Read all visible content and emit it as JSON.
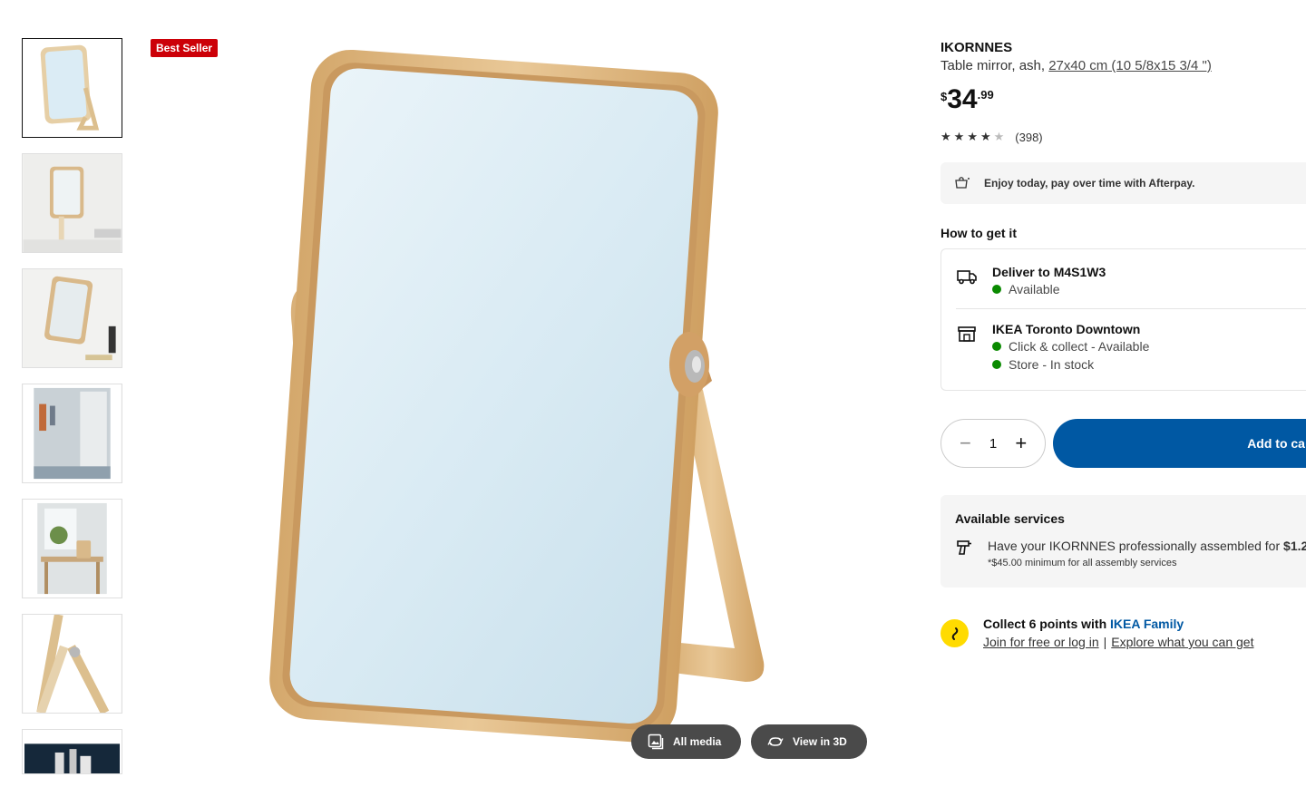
{
  "badge": "Best Seller",
  "thumbnails": [
    {
      "name": "mirror-front"
    },
    {
      "name": "mirror-on-shelf"
    },
    {
      "name": "mirror-with-decor"
    },
    {
      "name": "wall-hooks-room"
    },
    {
      "name": "desk-room-scene"
    },
    {
      "name": "hinge-detail"
    },
    {
      "name": "dark-shelf-scene"
    }
  ],
  "media_buttons": {
    "all_media": "All media",
    "view_3d": "View in 3D"
  },
  "product": {
    "name": "IKORNNES",
    "description": "Table mirror, ash,",
    "size": "27x40 cm (10 5/8x15 3/4 \")",
    "price_currency": "$",
    "price_int": "34",
    "price_dec": ".99",
    "rating_value": 4.5,
    "rating_count": "(398)"
  },
  "afterpay": {
    "icon": "afterpay-icon",
    "text": "Enjoy today, pay over time with Afterpay."
  },
  "how_to_get": {
    "heading": "How to get it",
    "delivery": {
      "title": "Deliver to M4S1W3",
      "status": "Available",
      "icon": "truck-icon"
    },
    "store": {
      "title": "IKEA Toronto Downtown",
      "status_1": "Click & collect - Available",
      "status_2": "Store - In stock",
      "icon": "store-icon"
    },
    "status_color": "#0a8a00"
  },
  "cart": {
    "quantity": "1",
    "minus": "−",
    "plus": "+",
    "add_label": "Add to ca",
    "color": "#0058a3"
  },
  "services": {
    "heading": "Available services",
    "text": "Have your IKORNNES professionally assembled for",
    "price": "$1.2",
    "note": "*$45.00 minimum for all assembly services",
    "icon": "drill-icon"
  },
  "family": {
    "title_prefix": "Collect 6 points with",
    "title_link": "IKEA Family",
    "link_join": "Join for free or log in",
    "separator": "|",
    "link_explore": "Explore what you can get",
    "logo_color": "#ffdb00"
  }
}
